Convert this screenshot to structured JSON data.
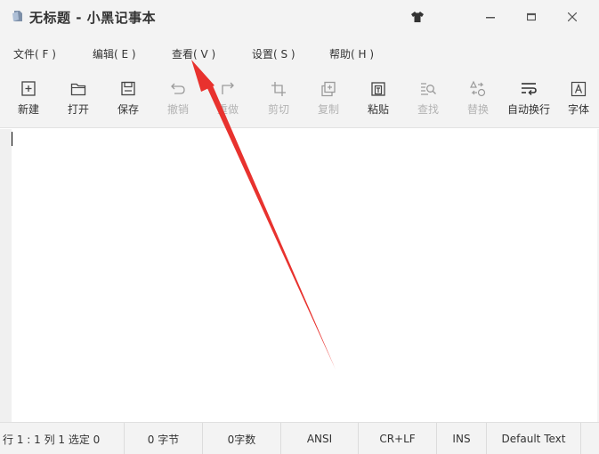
{
  "window": {
    "title": "无标题 - 小黑记事本"
  },
  "menu": {
    "items": [
      {
        "label": "文件( F )",
        "name": "menu-file"
      },
      {
        "label": "编辑( E )",
        "name": "menu-edit"
      },
      {
        "label": "查看( V )",
        "name": "menu-view"
      },
      {
        "label": "设置( S )",
        "name": "menu-settings"
      },
      {
        "label": "帮助( H )",
        "name": "menu-help"
      }
    ]
  },
  "toolbar": {
    "items": [
      {
        "label": "新建",
        "icon": "new-file-icon",
        "enabled": true
      },
      {
        "label": "打开",
        "icon": "open-folder-icon",
        "enabled": true
      },
      {
        "label": "保存",
        "icon": "save-icon",
        "enabled": true
      },
      {
        "label": "撤销",
        "icon": "undo-icon",
        "enabled": false
      },
      {
        "label": "重做",
        "icon": "redo-icon",
        "enabled": false
      },
      {
        "label": "剪切",
        "icon": "cut-icon",
        "enabled": false
      },
      {
        "label": "复制",
        "icon": "copy-icon",
        "enabled": false
      },
      {
        "label": "粘贴",
        "icon": "paste-icon",
        "enabled": true
      },
      {
        "label": "查找",
        "icon": "find-icon",
        "enabled": false
      },
      {
        "label": "替换",
        "icon": "replace-icon",
        "enabled": false
      },
      {
        "label": "自动换行",
        "icon": "word-wrap-icon",
        "enabled": true
      },
      {
        "label": "字体",
        "icon": "font-icon",
        "enabled": true
      }
    ]
  },
  "editor": {
    "content": ""
  },
  "status": {
    "position": "行 1 : 1   列 1   选定 0",
    "bytes": "0 字节",
    "chars": "0字数",
    "encoding": "ANSI",
    "line_ending": "CR+LF",
    "mode": "INS",
    "syntax": "Default Text"
  },
  "colors": {
    "chrome_bg": "#f3f3f3",
    "editor_bg": "#ffffff",
    "annotation_arrow": "#e8322e",
    "disabled_text": "#b3b3b3"
  }
}
